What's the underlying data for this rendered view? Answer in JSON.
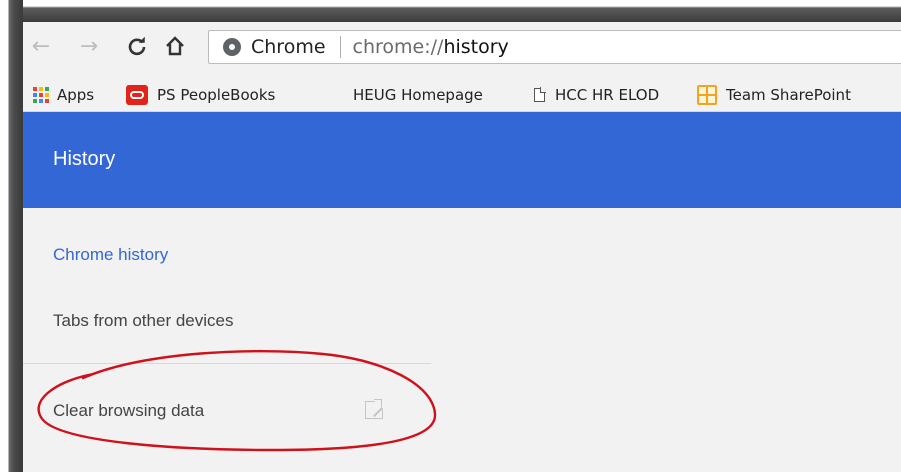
{
  "toolbar": {
    "back_icon": "back-arrow-icon",
    "forward_icon": "forward-arrow-icon",
    "reload_icon": "reload-icon",
    "home_icon": "home-icon",
    "omnibox_chip": "Chrome",
    "omnibox_url_prefix": "chrome://",
    "omnibox_url_path": "history"
  },
  "bookmarks": [
    {
      "label": "Apps",
      "icon": "apps-grid-icon"
    },
    {
      "label": "PS PeopleBooks",
      "icon": "oracle-icon"
    },
    {
      "label": "HEUG Homepage",
      "icon": ""
    },
    {
      "label": "HCC HR ELOD",
      "icon": "page-icon"
    },
    {
      "label": "Team SharePoint",
      "icon": "sharepoint-icon"
    }
  ],
  "header": {
    "title": "History"
  },
  "sidebar": {
    "items": [
      {
        "label": "Chrome history",
        "selected": true
      },
      {
        "label": "Tabs from other devices",
        "selected": false
      },
      {
        "label": "Clear browsing data",
        "selected": false,
        "icon": "external-link-icon"
      }
    ]
  },
  "colors": {
    "header_blue": "#3367d6",
    "annotation_red": "#d0101a"
  }
}
